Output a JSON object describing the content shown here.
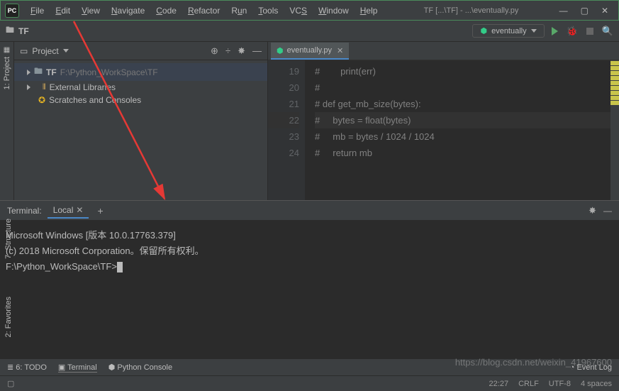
{
  "title": "TF [...\\TF] - ...\\eventually.py",
  "menu": [
    "File",
    "Edit",
    "View",
    "Navigate",
    "Code",
    "Refactor",
    "Run",
    "Tools",
    "VCS",
    "Window",
    "Help"
  ],
  "breadcrumb": "TF",
  "run_config": "eventually",
  "project": {
    "label": "Project",
    "root_name": "TF",
    "root_path": "F:\\Python_WorkSpace\\TF",
    "ext_lib": "External Libraries",
    "scratches": "Scratches and Consoles"
  },
  "tab": {
    "name": "eventually.py"
  },
  "code": {
    "lines": [
      {
        "n": "19",
        "t": "#        print(err)"
      },
      {
        "n": "20",
        "t": "#"
      },
      {
        "n": "21",
        "t": "# def get_mb_size(bytes):"
      },
      {
        "n": "22",
        "t": "#     bytes = float(bytes)"
      },
      {
        "n": "23",
        "t": "#     mb = bytes / 1024 / 1024"
      },
      {
        "n": "24",
        "t": "#     return mb"
      }
    ]
  },
  "terminal": {
    "title": "Terminal:",
    "tab": "Local",
    "lines": [
      "Microsoft Windows [版本 10.0.17763.379]",
      "(c) 2018 Microsoft Corporation。保留所有权利。",
      "",
      "F:\\Python_WorkSpace\\TF>"
    ]
  },
  "bottom": {
    "todo": "6: TODO",
    "terminal": "Terminal",
    "pyconsole": "Python Console",
    "eventlog": "Event Log"
  },
  "status": {
    "pos": "22:27",
    "sep": "CRLF",
    "enc": "UTF-8",
    "spaces": "4 spaces"
  },
  "rails": {
    "project": "1: Project",
    "structure": "7: Structure",
    "favorites": "2: Favorites"
  },
  "watermark": "https://blog.csdn.net/weixin_41967600"
}
